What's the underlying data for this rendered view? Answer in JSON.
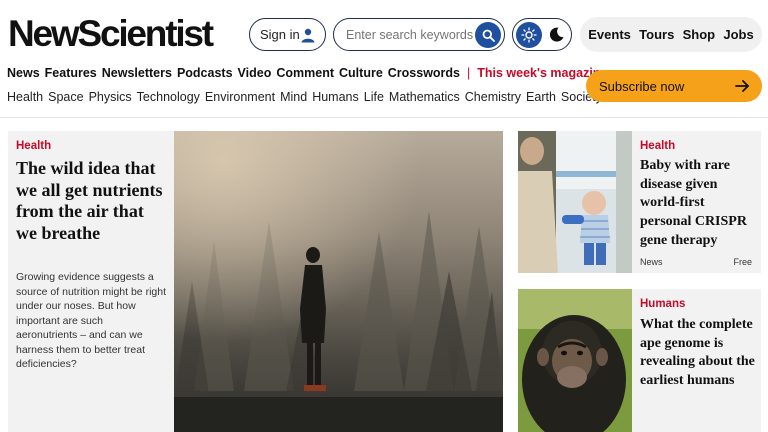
{
  "header": {
    "logo": "NewScientist",
    "sign_in": "Sign in",
    "search_placeholder": "Enter search keywords",
    "top_links": [
      "Events",
      "Tours",
      "Shop",
      "Jobs"
    ]
  },
  "nav_primary": [
    "News",
    "Features",
    "Newsletters",
    "Podcasts",
    "Video",
    "Comment",
    "Culture",
    "Crosswords"
  ],
  "nav_magazine": "This week's magazine",
  "nav_topics": [
    "Health",
    "Space",
    "Physics",
    "Technology",
    "Environment",
    "Mind",
    "Humans",
    "Life",
    "Mathematics",
    "Chemistry",
    "Earth",
    "Society"
  ],
  "subscribe": "Subscribe now",
  "lead": {
    "category": "Health",
    "headline": "The wild idea that we all get nutrients from the air that we breathe",
    "standfirst": "Growing evidence suggests a source of nutrition might be right under our noses. But how important are such aeronutrients – and can we harness them to better treat deficiencies?"
  },
  "cards": [
    {
      "category": "Health",
      "headline": "Baby with rare disease given world-first personal CRISPR gene therapy",
      "type": "News",
      "access": "Free"
    },
    {
      "category": "Humans",
      "headline": "What the complete ape genome is revealing about the earliest humans"
    }
  ],
  "colors": {
    "brand_dark": "#1f2d55",
    "accent_blue": "#1f4f9e",
    "category_red": "#c40a28",
    "subscribe_orange": "#f5a21a"
  }
}
